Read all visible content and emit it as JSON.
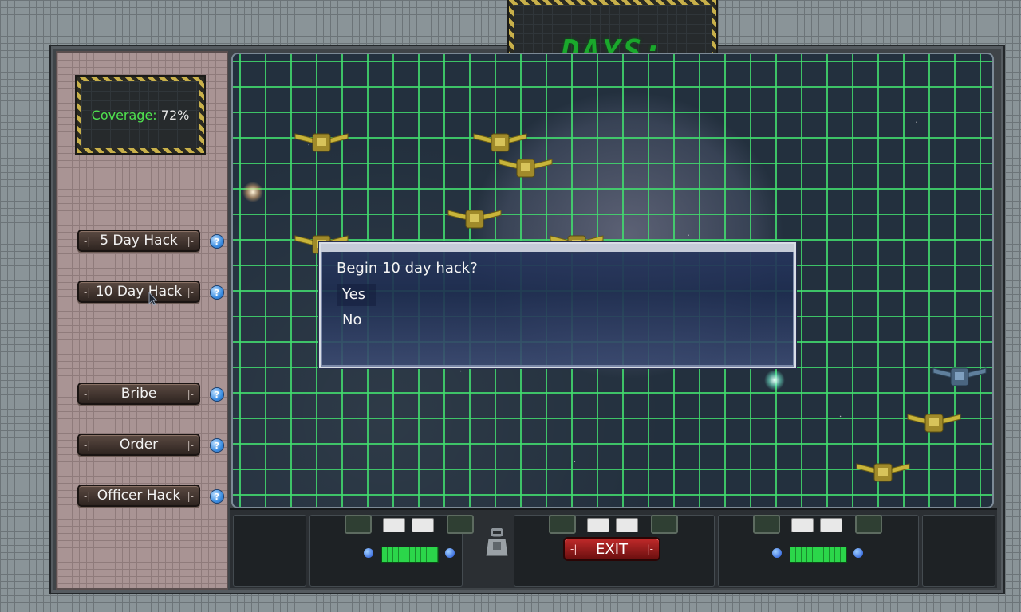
{
  "hud": {
    "coverage_label": "Coverage:",
    "coverage_value": "72%",
    "days_label": "DAYS:",
    "days_value": ""
  },
  "actions": [
    {
      "label": "5 Day Hack",
      "help": "?"
    },
    {
      "label": "10 Day Hack",
      "help": "?"
    },
    {
      "label": "Bribe",
      "help": "?"
    },
    {
      "label": "Order",
      "help": "?"
    },
    {
      "label": "Officer Hack",
      "help": "?"
    }
  ],
  "dialog": {
    "prompt": "Begin 10 day hack?",
    "options": [
      "Yes",
      "No"
    ],
    "selected": "Yes"
  },
  "console": {
    "exit_label": "EXIT"
  },
  "colors": {
    "grid": "#42dc6e",
    "days_digits": "#1aa82c",
    "coverage_label": "#4fe24f",
    "exit_button": "#c02a2a"
  },
  "icons": [
    "satellite-icon",
    "help-icon",
    "robot-icon",
    "mouse-cursor-icon",
    "gauge-icon"
  ]
}
